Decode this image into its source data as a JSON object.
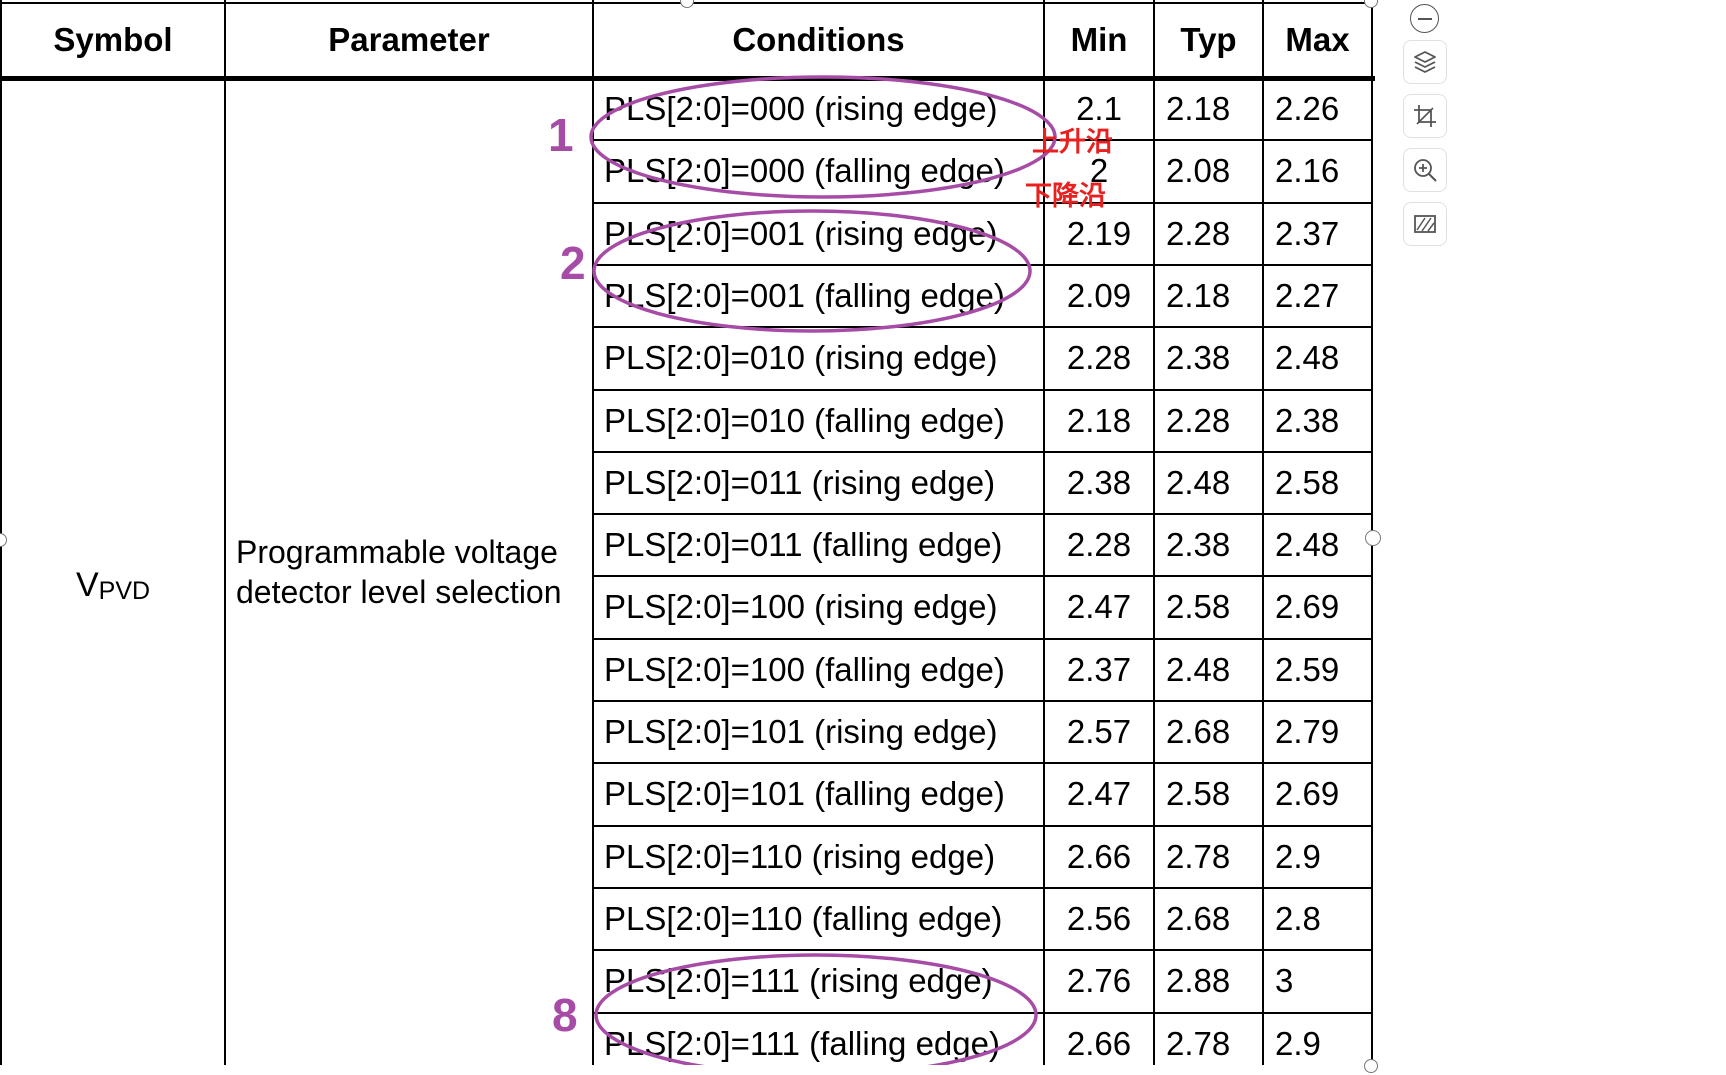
{
  "table": {
    "headers": {
      "symbol": "Symbol",
      "parameter": "Parameter",
      "conditions": "Conditions",
      "min": "Min",
      "typ": "Typ",
      "max": "Max"
    },
    "symbol_main": "V",
    "symbol_sub": "PVD",
    "parameter_line1": "Programmable voltage",
    "parameter_line2": "detector level selection",
    "rows": [
      {
        "condition": "PLS[2:0]=000 (rising edge)",
        "min": "2.1",
        "typ": "2.18",
        "max": "2.26"
      },
      {
        "condition": "PLS[2:0]=000 (falling edge)",
        "min": "2",
        "typ": "2.08",
        "max": "2.16"
      },
      {
        "condition": "PLS[2:0]=001 (rising edge)",
        "min": "2.19",
        "typ": "2.28",
        "max": "2.37"
      },
      {
        "condition": "PLS[2:0]=001 (falling edge)",
        "min": "2.09",
        "typ": "2.18",
        "max": "2.27"
      },
      {
        "condition": "PLS[2:0]=010 (rising edge)",
        "min": "2.28",
        "typ": "2.38",
        "max": "2.48"
      },
      {
        "condition": "PLS[2:0]=010 (falling edge)",
        "min": "2.18",
        "typ": "2.28",
        "max": "2.38"
      },
      {
        "condition": "PLS[2:0]=011 (rising edge)",
        "min": "2.38",
        "typ": "2.48",
        "max": "2.58"
      },
      {
        "condition": "PLS[2:0]=011 (falling edge)",
        "min": "2.28",
        "typ": "2.38",
        "max": "2.48"
      },
      {
        "condition": "PLS[2:0]=100 (rising edge)",
        "min": "2.47",
        "typ": "2.58",
        "max": "2.69"
      },
      {
        "condition": "PLS[2:0]=100 (falling edge)",
        "min": "2.37",
        "typ": "2.48",
        "max": "2.59"
      },
      {
        "condition": "PLS[2:0]=101 (rising edge)",
        "min": "2.57",
        "typ": "2.68",
        "max": "2.79"
      },
      {
        "condition": "PLS[2:0]=101 (falling edge)",
        "min": "2.47",
        "typ": "2.58",
        "max": "2.69"
      },
      {
        "condition": "PLS[2:0]=110 (rising edge)",
        "min": "2.66",
        "typ": "2.78",
        "max": "2.9"
      },
      {
        "condition": "PLS[2:0]=110 (falling edge)",
        "min": "2.56",
        "typ": "2.68",
        "max": "2.8"
      },
      {
        "condition": "PLS[2:0]=111 (rising edge)",
        "min": "2.76",
        "typ": "2.88",
        "max": "3"
      },
      {
        "condition": "PLS[2:0]=111 (falling edge)",
        "min": "2.66",
        "typ": "2.78",
        "max": "2.9"
      }
    ]
  },
  "annotations": {
    "marker_1": "1",
    "marker_2": "2",
    "marker_8": "8",
    "rising_note": "上升沿",
    "falling_note": "下降沿",
    "ellipse_color": "#a64ca6",
    "note_color": "#e82020"
  },
  "toolbar": {
    "items": [
      "minus-icon",
      "layers-icon",
      "crop-icon",
      "zoom-in-icon",
      "hatch-icon"
    ]
  }
}
